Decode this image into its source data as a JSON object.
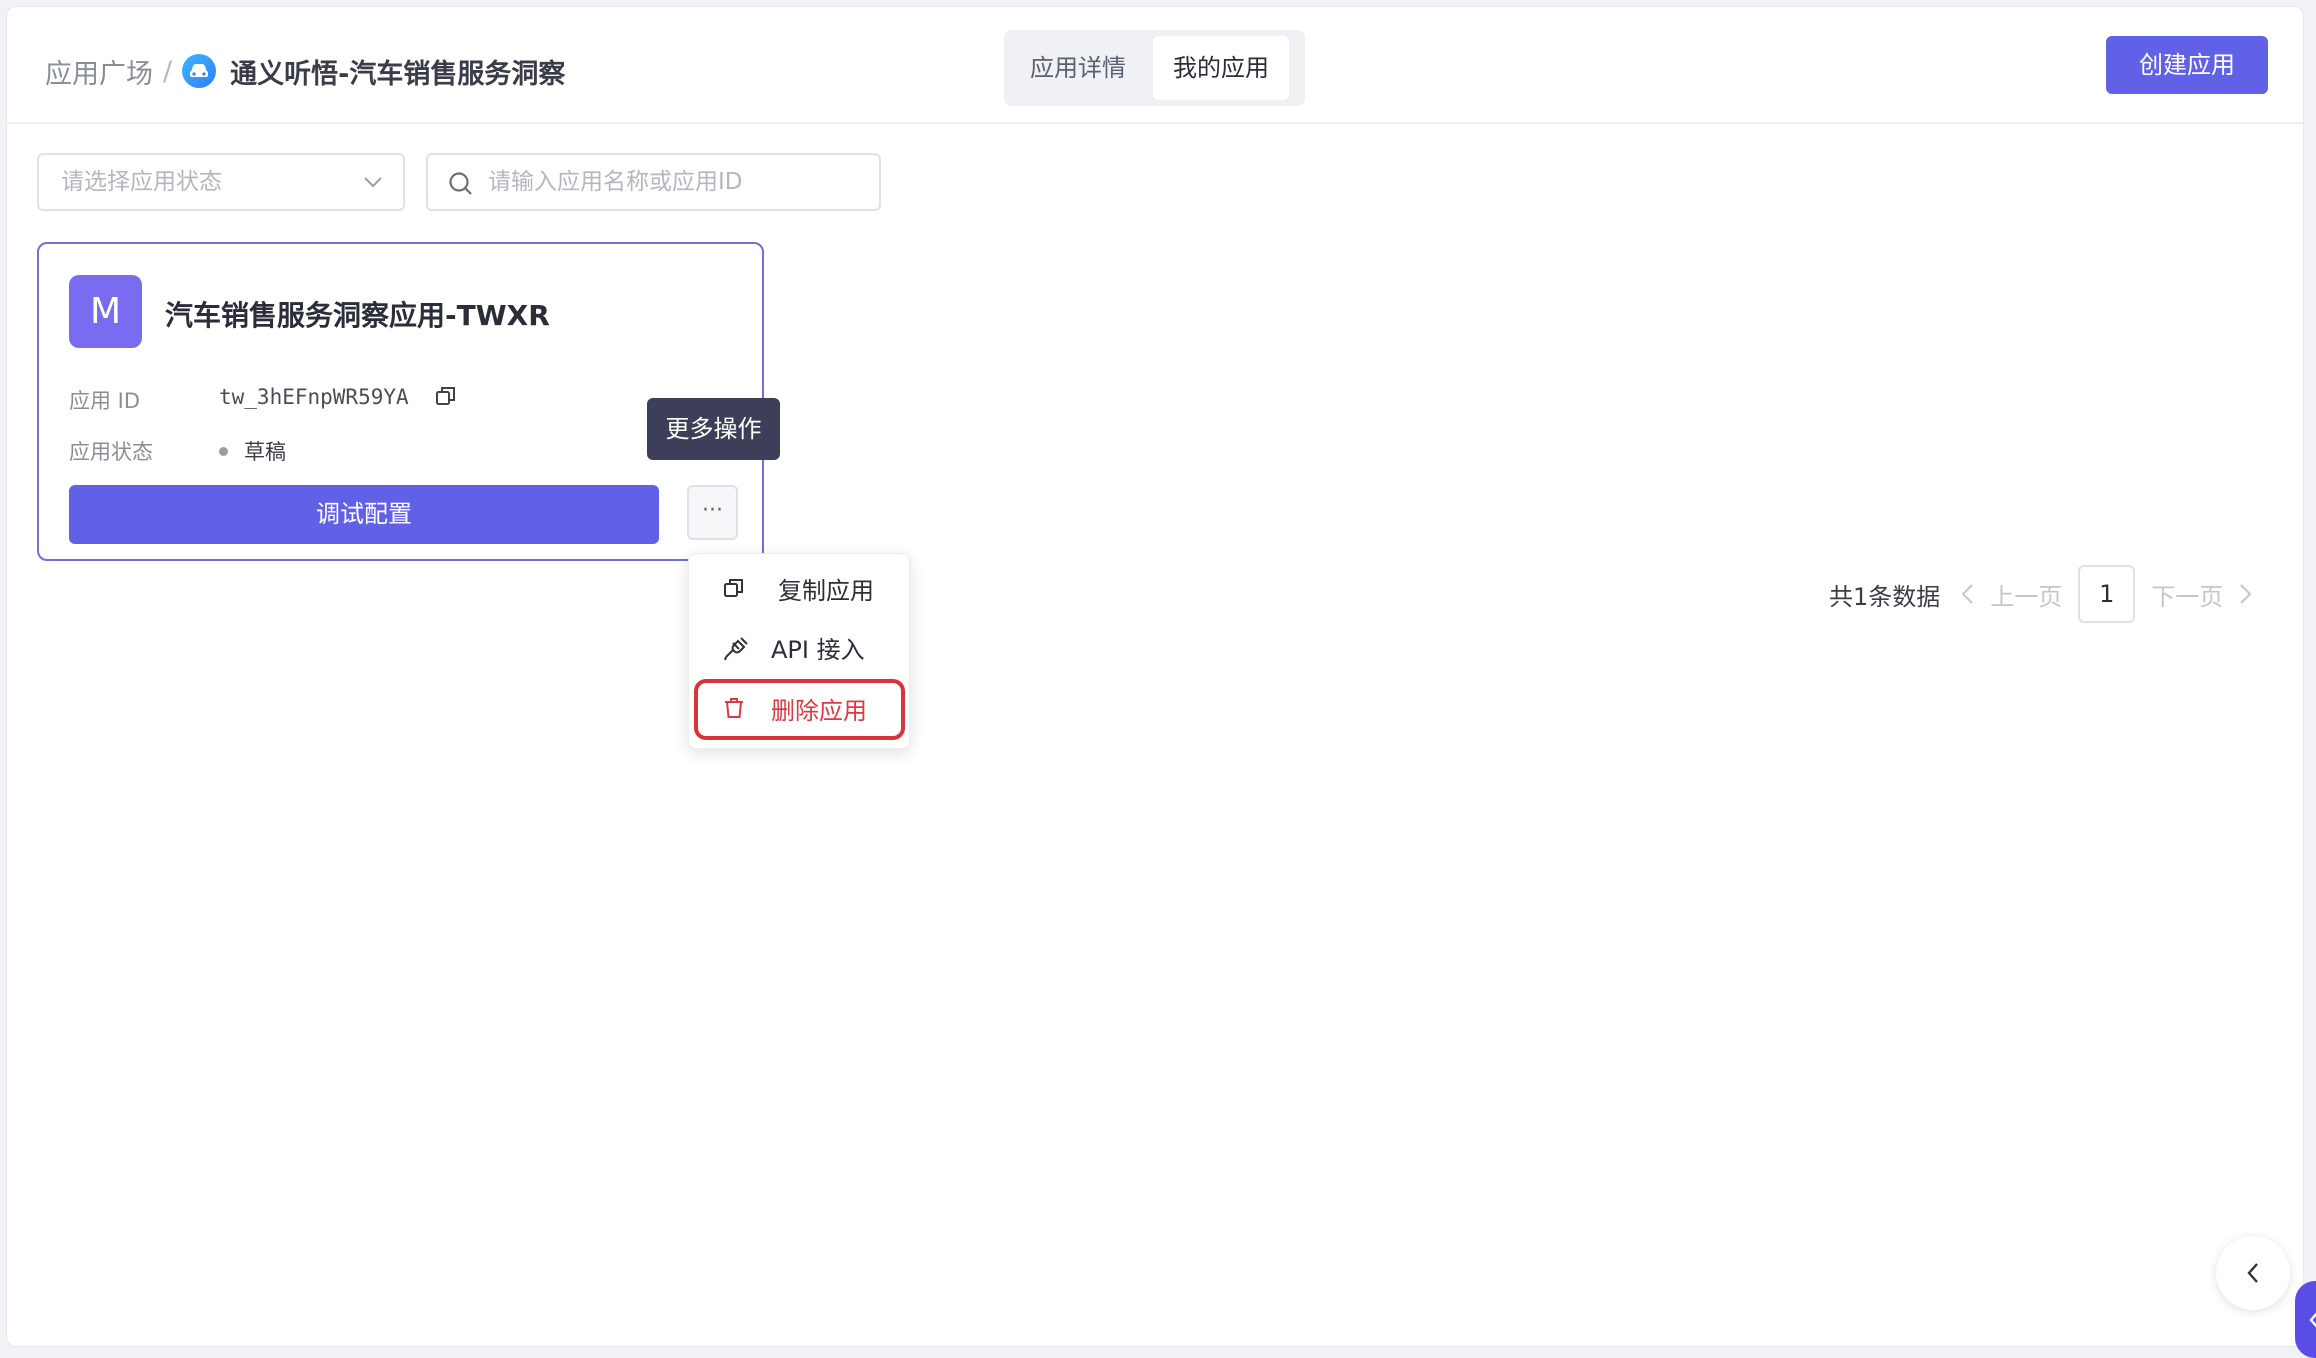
{
  "header": {
    "breadcrumb_root": "应用广场",
    "breadcrumb_sep": "/",
    "breadcrumb_current": "通义听悟-汽车销售服务洞察",
    "tabs": [
      {
        "label": "应用详情"
      },
      {
        "label": "我的应用"
      }
    ],
    "create_label": "创建应用"
  },
  "filters": {
    "status_placeholder": "请选择应用状态",
    "search_placeholder": "请输入应用名称或应用ID"
  },
  "card": {
    "avatar_letter": "M",
    "name": "汽车销售服务洞察应用-TWXR",
    "id_label": "应用 ID",
    "id_value": "tw_3hEFnpWR59YA",
    "status_label": "应用状态",
    "status_value": "草稿",
    "debug_label": "调试配置",
    "more_label": "···"
  },
  "tooltip": "更多操作",
  "menu": {
    "items": [
      {
        "label": "复制应用",
        "icon": "copy-icon"
      },
      {
        "label": "API 接入",
        "icon": "plug-icon"
      },
      {
        "label": "删除应用",
        "icon": "trash-icon"
      }
    ]
  },
  "pagination": {
    "total": "共1条数据",
    "prev": "上一页",
    "page": "1",
    "next": "下一页"
  },
  "colors": {
    "primary": "#6161e8",
    "danger": "#e0383c",
    "tooltip_bg": "#3c3f57"
  }
}
